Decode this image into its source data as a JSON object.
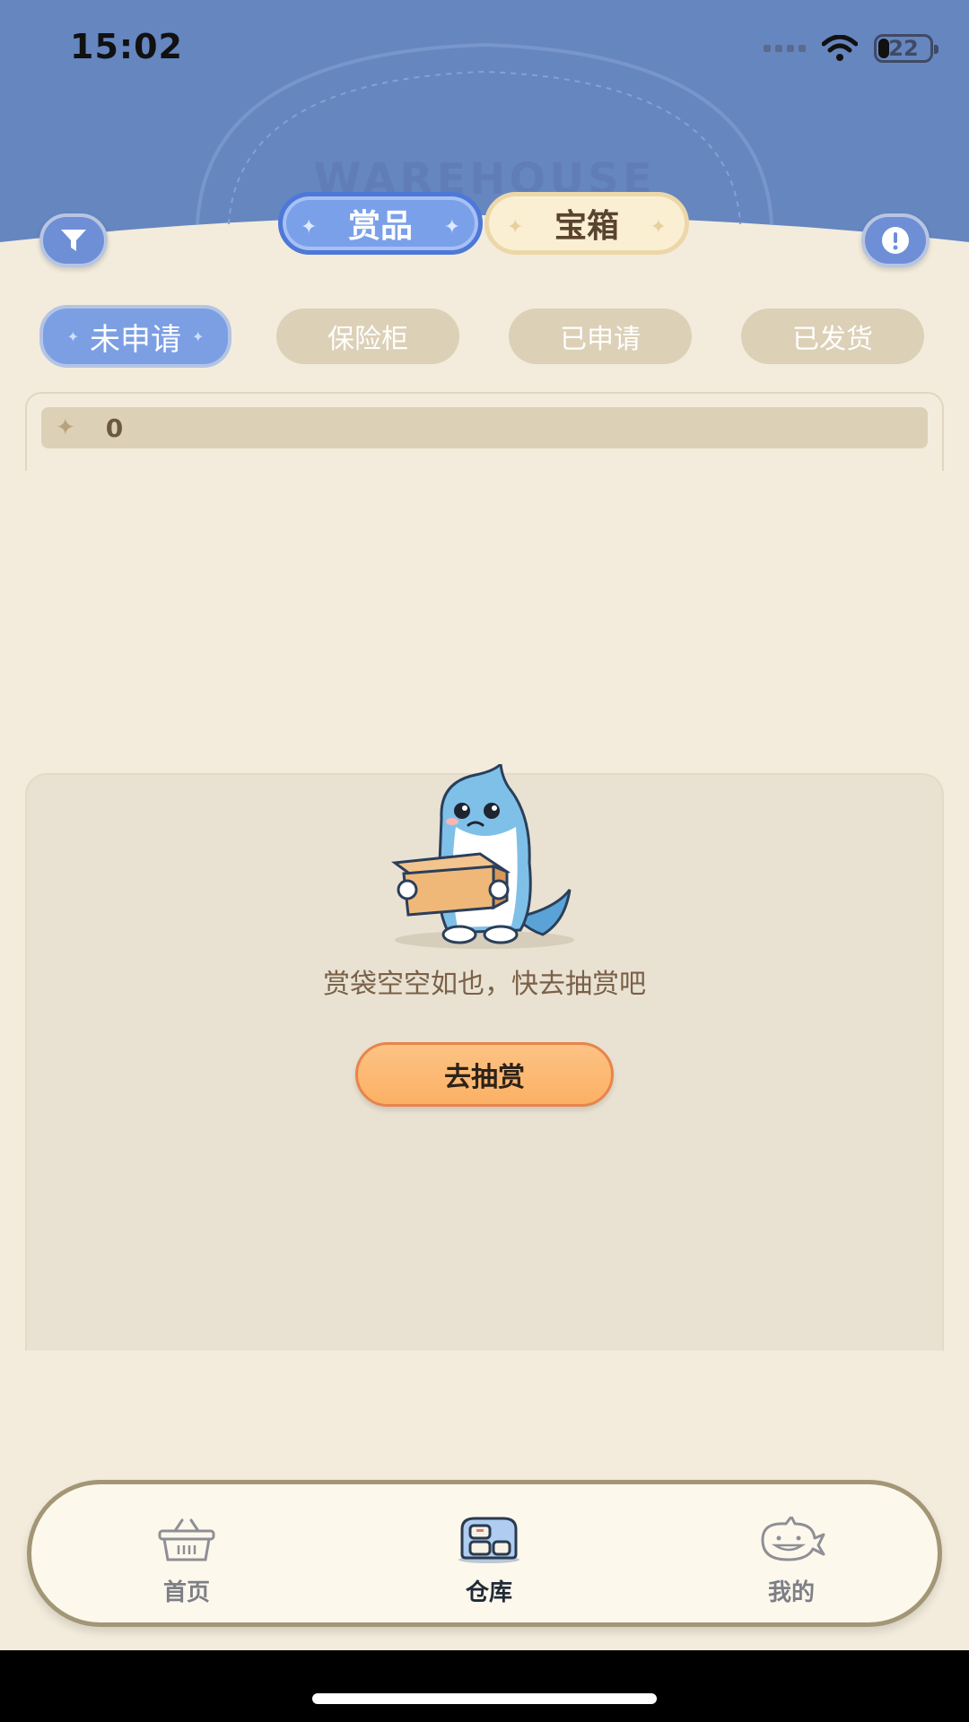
{
  "status_bar": {
    "time": "15:02",
    "battery": "22"
  },
  "header": {
    "watermark": "WAREHOUSE",
    "tabs": [
      {
        "label": "赏品",
        "active": true
      },
      {
        "label": "宝箱",
        "active": false
      }
    ]
  },
  "sub_tabs": [
    {
      "label": "未申请",
      "active": true
    },
    {
      "label": "保险柜",
      "active": false
    },
    {
      "label": "已申请",
      "active": false
    },
    {
      "label": "已发货",
      "active": false
    }
  ],
  "count": {
    "value": "0"
  },
  "empty_state": {
    "message": "赏袋空空如也，快去抽赏吧",
    "button_label": "去抽赏"
  },
  "bottom_nav": {
    "items": [
      {
        "label": "首页",
        "icon": "basket-icon",
        "active": false
      },
      {
        "label": "仓库",
        "icon": "warehouse-icon",
        "active": true
      },
      {
        "label": "我的",
        "icon": "shark-face-icon",
        "active": false
      }
    ]
  },
  "colors": {
    "header_blue": "#6b89c2",
    "page_bg": "#f3ecdc",
    "accent_blue": "#7c9fe4",
    "button_orange": "#fbb165"
  }
}
